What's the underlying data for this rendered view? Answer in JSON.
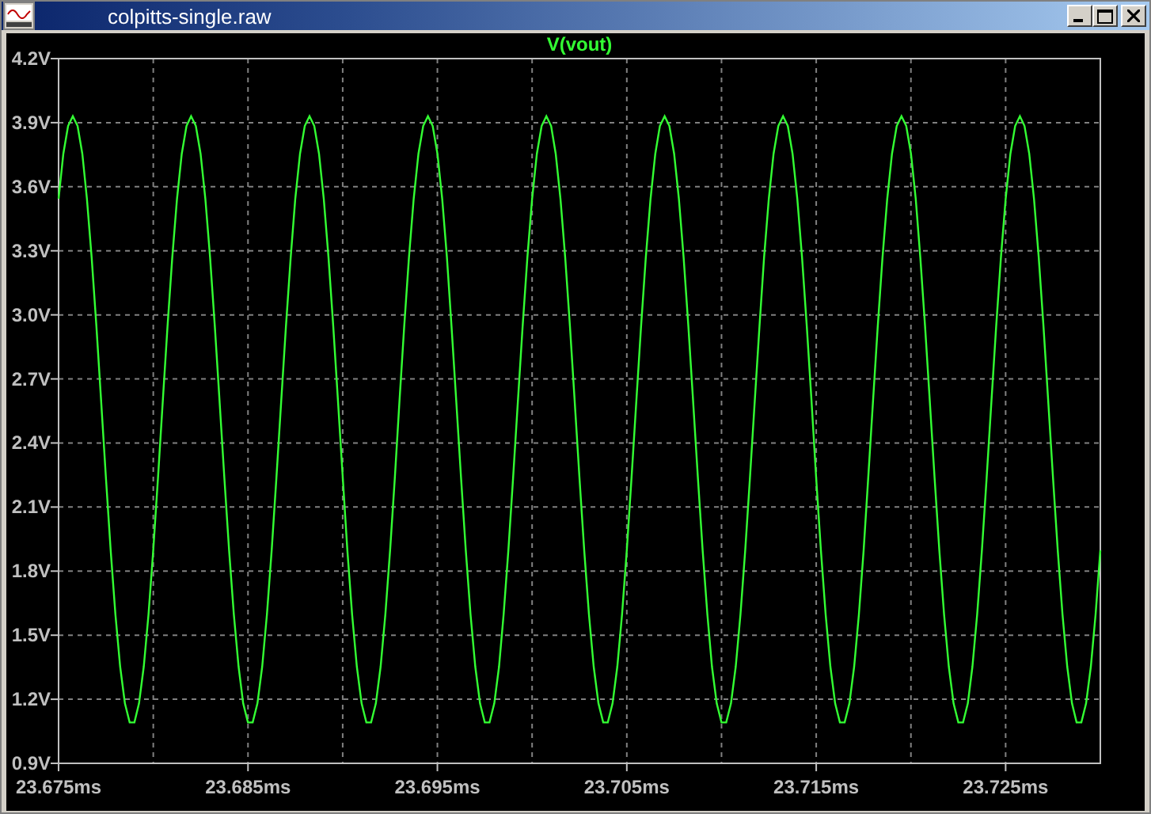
{
  "window": {
    "title": "colpitts-single.raw"
  },
  "plot": {
    "chart_data": {
      "type": "line",
      "grid": true,
      "x": [
        23.675,
        23.67525,
        23.6755,
        23.67575,
        23.676,
        23.67625,
        23.6765,
        23.67675,
        23.677,
        23.67725,
        23.6775,
        23.67775,
        23.678,
        23.67825,
        23.6785,
        23.67875,
        23.679,
        23.67925,
        23.6795,
        23.67975,
        23.68,
        23.68025,
        23.6805,
        23.68075,
        23.681,
        23.68125,
        23.6815,
        23.68175,
        23.682,
        23.68225,
        23.6825,
        23.68275,
        23.683,
        23.68325,
        23.6835,
        23.68375,
        23.684,
        23.68425,
        23.6845,
        23.68475,
        23.685,
        23.68525,
        23.6855,
        23.68575,
        23.686,
        23.68625,
        23.6865,
        23.68675,
        23.687,
        23.68725,
        23.6875,
        23.68775,
        23.688,
        23.68825,
        23.6885,
        23.68875,
        23.689,
        23.68925,
        23.6895,
        23.68975,
        23.69,
        23.69025,
        23.6905,
        23.69075,
        23.691,
        23.69125,
        23.6915,
        23.69175,
        23.692,
        23.69225,
        23.6925,
        23.69275,
        23.693,
        23.69325,
        23.6935,
        23.69375,
        23.694,
        23.69425,
        23.6945,
        23.69475,
        23.695,
        23.69525,
        23.6955,
        23.69575,
        23.696,
        23.69625,
        23.6965,
        23.69675,
        23.697,
        23.69725,
        23.6975,
        23.69775,
        23.698,
        23.69825,
        23.6985,
        23.69875,
        23.699,
        23.69925,
        23.6995,
        23.69975,
        23.7,
        23.70025,
        23.7005,
        23.70075,
        23.701,
        23.70125,
        23.7015,
        23.70175,
        23.702,
        23.70225,
        23.7025,
        23.70275,
        23.703,
        23.70325,
        23.7035,
        23.70375,
        23.704,
        23.70425,
        23.7045,
        23.70475,
        23.705,
        23.70525,
        23.7055,
        23.70575,
        23.706,
        23.70625,
        23.7065,
        23.70675,
        23.707,
        23.70725,
        23.7075,
        23.70775,
        23.708,
        23.70825,
        23.7085,
        23.70875,
        23.709,
        23.70925,
        23.7095,
        23.70975,
        23.71,
        23.71025,
        23.7105,
        23.71075,
        23.711,
        23.71125,
        23.7115,
        23.71175,
        23.712,
        23.71225,
        23.7125,
        23.71275,
        23.713,
        23.71325,
        23.7135,
        23.71375,
        23.714,
        23.71425,
        23.7145,
        23.71475,
        23.715,
        23.71525,
        23.7155,
        23.71575,
        23.716,
        23.71625,
        23.7165,
        23.71675,
        23.717,
        23.71725,
        23.7175,
        23.71775,
        23.718,
        23.71825,
        23.7185,
        23.71875,
        23.719,
        23.71925,
        23.7195,
        23.71975,
        23.72,
        23.72025,
        23.7205,
        23.72075,
        23.721,
        23.72125,
        23.7215,
        23.72175,
        23.722,
        23.72225,
        23.7225,
        23.72275,
        23.723,
        23.72325,
        23.7235,
        23.72375,
        23.724,
        23.72425,
        23.7245,
        23.72475,
        23.725,
        23.72525,
        23.7255,
        23.72575,
        23.726,
        23.72625,
        23.7265,
        23.72675,
        23.727,
        23.72725,
        23.7275,
        23.72775,
        23.728,
        23.72825,
        23.7285,
        23.72875,
        23.729,
        23.72925,
        23.7295,
        23.72975,
        23.73
      ],
      "series": [
        {
          "name": "V(vout)",
          "color": "#33ff33",
          "values": [
            3.544,
            3.754,
            3.885,
            3.93,
            3.885,
            3.754,
            3.544,
            3.268,
            2.945,
            2.594,
            2.238,
            1.898,
            1.597,
            1.352,
            1.18,
            1.091,
            1.091,
            1.18,
            1.352,
            1.597,
            1.898,
            2.238,
            2.594,
            2.945,
            3.268,
            3.544,
            3.754,
            3.885,
            3.93,
            3.885,
            3.754,
            3.544,
            3.268,
            2.945,
            2.594,
            2.238,
            1.898,
            1.597,
            1.352,
            1.18,
            1.091,
            1.091,
            1.18,
            1.352,
            1.597,
            1.898,
            2.238,
            2.594,
            2.945,
            3.268,
            3.544,
            3.754,
            3.885,
            3.93,
            3.885,
            3.754,
            3.544,
            3.268,
            2.945,
            2.594,
            2.238,
            1.898,
            1.597,
            1.352,
            1.18,
            1.091,
            1.091,
            1.18,
            1.352,
            1.597,
            1.898,
            2.238,
            2.594,
            2.945,
            3.268,
            3.544,
            3.754,
            3.885,
            3.93,
            3.885,
            3.754,
            3.544,
            3.268,
            2.945,
            2.594,
            2.238,
            1.898,
            1.597,
            1.352,
            1.18,
            1.091,
            1.091,
            1.18,
            1.352,
            1.597,
            1.898,
            2.238,
            2.594,
            2.945,
            3.268,
            3.544,
            3.754,
            3.885,
            3.93,
            3.885,
            3.754,
            3.544,
            3.268,
            2.945,
            2.594,
            2.238,
            1.898,
            1.597,
            1.352,
            1.18,
            1.091,
            1.091,
            1.18,
            1.352,
            1.597,
            1.898,
            2.238,
            2.594,
            2.945,
            3.268,
            3.544,
            3.754,
            3.885,
            3.93,
            3.885,
            3.754,
            3.544,
            3.268,
            2.945,
            2.594,
            2.238,
            1.898,
            1.597,
            1.352,
            1.18,
            1.091,
            1.091,
            1.18,
            1.352,
            1.597,
            1.898,
            2.238,
            2.594,
            2.945,
            3.268,
            3.544,
            3.754,
            3.885,
            3.93,
            3.885,
            3.754,
            3.544,
            3.268,
            2.945,
            2.594,
            2.238,
            1.898,
            1.597,
            1.352,
            1.18,
            1.091,
            1.091,
            1.18,
            1.352,
            1.597,
            1.898,
            2.238,
            2.594,
            2.945,
            3.268,
            3.544,
            3.754,
            3.885,
            3.93,
            3.885,
            3.754,
            3.544,
            3.268,
            2.945,
            2.594,
            2.238,
            1.898,
            1.597,
            1.352,
            1.18,
            1.091,
            1.091,
            1.18,
            1.352,
            1.597,
            1.898,
            2.238,
            2.594,
            2.945,
            3.268,
            3.544,
            3.754,
            3.885,
            3.93,
            3.885,
            3.754,
            3.544,
            3.268,
            2.945,
            2.594,
            2.238,
            1.898,
            1.597,
            1.352,
            1.18,
            1.091,
            1.091,
            1.18,
            1.352,
            1.597,
            1.898
          ]
        }
      ],
      "xlim": [
        23.675,
        23.73
      ],
      "ylim": [
        0.9,
        4.2
      ],
      "xticks": [
        {
          "value": 23.675,
          "label": "23.675ms"
        },
        {
          "value": 23.685,
          "label": "23.685ms"
        },
        {
          "value": 23.695,
          "label": "23.695ms"
        },
        {
          "value": 23.705,
          "label": "23.705ms"
        },
        {
          "value": 23.715,
          "label": "23.715ms"
        },
        {
          "value": 23.725,
          "label": "23.725ms"
        }
      ],
      "yticks": [
        {
          "value": 0.9,
          "label": "0.9V"
        },
        {
          "value": 1.2,
          "label": "1.2V"
        },
        {
          "value": 1.5,
          "label": "1.5V"
        },
        {
          "value": 1.8,
          "label": "1.8V"
        },
        {
          "value": 2.1,
          "label": "2.1V"
        },
        {
          "value": 2.4,
          "label": "2.4V"
        },
        {
          "value": 2.7,
          "label": "2.7V"
        },
        {
          "value": 3.0,
          "label": "3.0V"
        },
        {
          "value": 3.3,
          "label": "3.3V"
        },
        {
          "value": 3.6,
          "label": "3.6V"
        },
        {
          "value": 3.9,
          "label": "3.9V"
        },
        {
          "value": 4.2,
          "label": "4.2V"
        }
      ]
    }
  }
}
